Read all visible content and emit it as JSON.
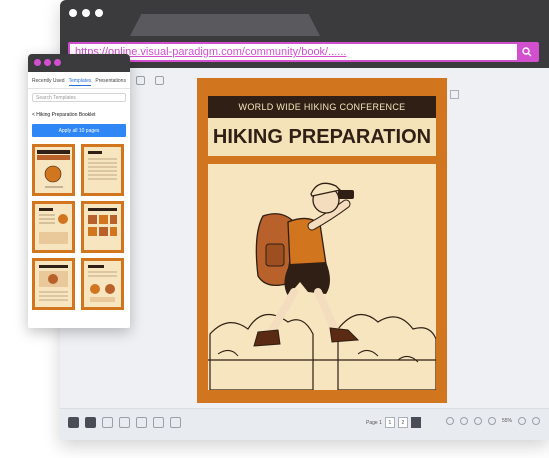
{
  "browser": {
    "url": "https://online.visual-paradigm.com/community/book/......"
  },
  "poster": {
    "conference": "WORLD WIDE HIKING CONFERENCE",
    "title": "HIKING PREPARATION"
  },
  "bottombar": {
    "page_label": "Page 1",
    "page_current": "1",
    "page_total": "2",
    "zoom": "55%"
  },
  "panel": {
    "tabs": [
      "Recently Used",
      "Templates",
      "Presentations"
    ],
    "active_tab": "Templates",
    "search_placeholder": "Search Templates",
    "back_label": "< Hiking Preparation Booklet",
    "apply_label": "Apply all 10 pages"
  },
  "colors": {
    "accent": "#d24fd0",
    "poster_orange": "#d1751f",
    "poster_cream": "#f6e5be",
    "poster_dark": "#2f1f14",
    "apply_blue": "#2f86f5"
  },
  "icons": [
    "search-icon",
    "pages-icon",
    "copy-icon",
    "undo-icon",
    "redo-icon",
    "zoom-icon",
    "fullscreen-icon"
  ]
}
